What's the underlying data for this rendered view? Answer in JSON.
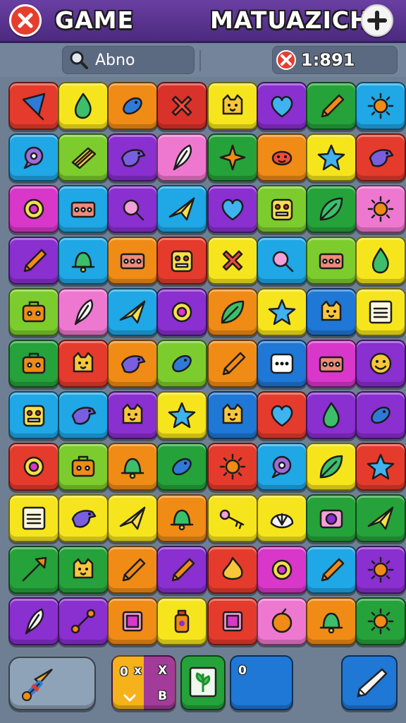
{
  "header": {
    "title_left": "GAME",
    "title_right": "MATUAZICH",
    "close_icon": "close-icon",
    "add_icon": "plus-icon"
  },
  "status": {
    "search_label": "Abno",
    "timer_value": "1:891"
  },
  "board": {
    "columns": 8,
    "rows": 11,
    "tiles": [
      [
        {
          "c": "#e53b2c",
          "i": "cone"
        },
        {
          "c": "#f6e51c",
          "i": "drop"
        },
        {
          "c": "#f08b16",
          "i": "fish"
        },
        {
          "c": "#d9322a",
          "i": "cross"
        },
        {
          "c": "#f6e51c",
          "i": "cat"
        },
        {
          "c": "#8a2fd0",
          "i": "heart"
        },
        {
          "c": "#25a23a",
          "i": "pencil"
        },
        {
          "c": "#1fa7e6",
          "i": "sun"
        }
      ],
      [
        {
          "c": "#1fa7e6",
          "i": "bubble"
        },
        {
          "c": "#7ccc2e",
          "i": "book"
        },
        {
          "c": "#8a2fd0",
          "i": "bird"
        },
        {
          "c": "#ee78cf",
          "i": "feather"
        },
        {
          "c": "#25a23a",
          "i": "star4"
        },
        {
          "c": "#f08b16",
          "i": "blob"
        },
        {
          "c": "#f6e51c",
          "i": "star"
        },
        {
          "c": "#e53b2c",
          "i": "bird"
        }
      ],
      [
        {
          "c": "#d837c9",
          "i": "ring"
        },
        {
          "c": "#1fa7e6",
          "i": "panel"
        },
        {
          "c": "#8a2fd0",
          "i": "magnifier"
        },
        {
          "c": "#1fa7e6",
          "i": "plane"
        },
        {
          "c": "#8a2fd0",
          "i": "heart"
        },
        {
          "c": "#7ccc2e",
          "i": "robot"
        },
        {
          "c": "#25a23a",
          "i": "leaf"
        },
        {
          "c": "#ee78cf",
          "i": "sun"
        }
      ],
      [
        {
          "c": "#8a2fd0",
          "i": "pencil"
        },
        {
          "c": "#1fa7e6",
          "i": "bell"
        },
        {
          "c": "#f08b16",
          "i": "panel"
        },
        {
          "c": "#e53b2c",
          "i": "robot"
        },
        {
          "c": "#f6e51c",
          "i": "cross"
        },
        {
          "c": "#1fa7e6",
          "i": "magnifier"
        },
        {
          "c": "#7ccc2e",
          "i": "panel"
        },
        {
          "c": "#f6e51c",
          "i": "drop"
        }
      ],
      [
        {
          "c": "#7ccc2e",
          "i": "bag"
        },
        {
          "c": "#ee78cf",
          "i": "feather"
        },
        {
          "c": "#1fa7e6",
          "i": "plane"
        },
        {
          "c": "#8a2fd0",
          "i": "ring"
        },
        {
          "c": "#f08b16",
          "i": "leaf"
        },
        {
          "c": "#f6e51c",
          "i": "star"
        },
        {
          "c": "#1f77d6",
          "i": "cat"
        },
        {
          "c": "#f6e51c",
          "i": "note"
        }
      ],
      [
        {
          "c": "#25a23a",
          "i": "bag"
        },
        {
          "c": "#e53b2c",
          "i": "cat"
        },
        {
          "c": "#f08b16",
          "i": "bird"
        },
        {
          "c": "#7ccc2e",
          "i": "fish"
        },
        {
          "c": "#f08b16",
          "i": "pencil"
        },
        {
          "c": "#1f77d6",
          "i": "dice"
        },
        {
          "c": "#d837c9",
          "i": "panel"
        },
        {
          "c": "#8a2fd0",
          "i": "smile"
        }
      ],
      [
        {
          "c": "#1fa7e6",
          "i": "robot"
        },
        {
          "c": "#1fa7e6",
          "i": "bird"
        },
        {
          "c": "#8a2fd0",
          "i": "cat"
        },
        {
          "c": "#f6e51c",
          "i": "star"
        },
        {
          "c": "#1f77d6",
          "i": "cat"
        },
        {
          "c": "#e53b2c",
          "i": "heart"
        },
        {
          "c": "#8a2fd0",
          "i": "drop"
        },
        {
          "c": "#8a2fd0",
          "i": "fish"
        }
      ],
      [
        {
          "c": "#e53b2c",
          "i": "ring"
        },
        {
          "c": "#7ccc2e",
          "i": "bag"
        },
        {
          "c": "#f08b16",
          "i": "bell"
        },
        {
          "c": "#25a23a",
          "i": "fish"
        },
        {
          "c": "#e53b2c",
          "i": "sun"
        },
        {
          "c": "#1fa7e6",
          "i": "bubble"
        },
        {
          "c": "#f6e51c",
          "i": "leaf"
        },
        {
          "c": "#e53b2c",
          "i": "star"
        }
      ],
      [
        {
          "c": "#f6e51c",
          "i": "note"
        },
        {
          "c": "#f6e51c",
          "i": "bird"
        },
        {
          "c": "#f6e51c",
          "i": "plane"
        },
        {
          "c": "#f08b16",
          "i": "bell"
        },
        {
          "c": "#f6e51c",
          "i": "key"
        },
        {
          "c": "#f6e51c",
          "i": "shell"
        },
        {
          "c": "#25a23a",
          "i": "camera"
        },
        {
          "c": "#25a23a",
          "i": "plane"
        }
      ],
      [
        {
          "c": "#25a23a",
          "i": "arrow"
        },
        {
          "c": "#25a23a",
          "i": "cat"
        },
        {
          "c": "#f08b16",
          "i": "pencil"
        },
        {
          "c": "#8a2fd0",
          "i": "pencil"
        },
        {
          "c": "#e53b2c",
          "i": "fire"
        },
        {
          "c": "#d837c9",
          "i": "ring"
        },
        {
          "c": "#1fa7e6",
          "i": "pencil"
        },
        {
          "c": "#8a2fd0",
          "i": "sun"
        }
      ],
      [
        {
          "c": "#8a2fd0",
          "i": "feather"
        },
        {
          "c": "#8a2fd0",
          "i": "bone"
        },
        {
          "c": "#f08b16",
          "i": "frame"
        },
        {
          "c": "#f6e51c",
          "i": "bottle"
        },
        {
          "c": "#e53b2c",
          "i": "frame"
        },
        {
          "c": "#ee78cf",
          "i": "fruit"
        },
        {
          "c": "#f08b16",
          "i": "bell"
        },
        {
          "c": "#25a23a",
          "i": "sun"
        }
      ]
    ]
  },
  "tools": {
    "swap_labels": [
      "0",
      "x",
      "X",
      "B"
    ],
    "blank_label": "0",
    "rocket_icon": "rocket-icon",
    "leaf_icon": "leaf-card-icon",
    "pen_icon": "pen-icon"
  }
}
